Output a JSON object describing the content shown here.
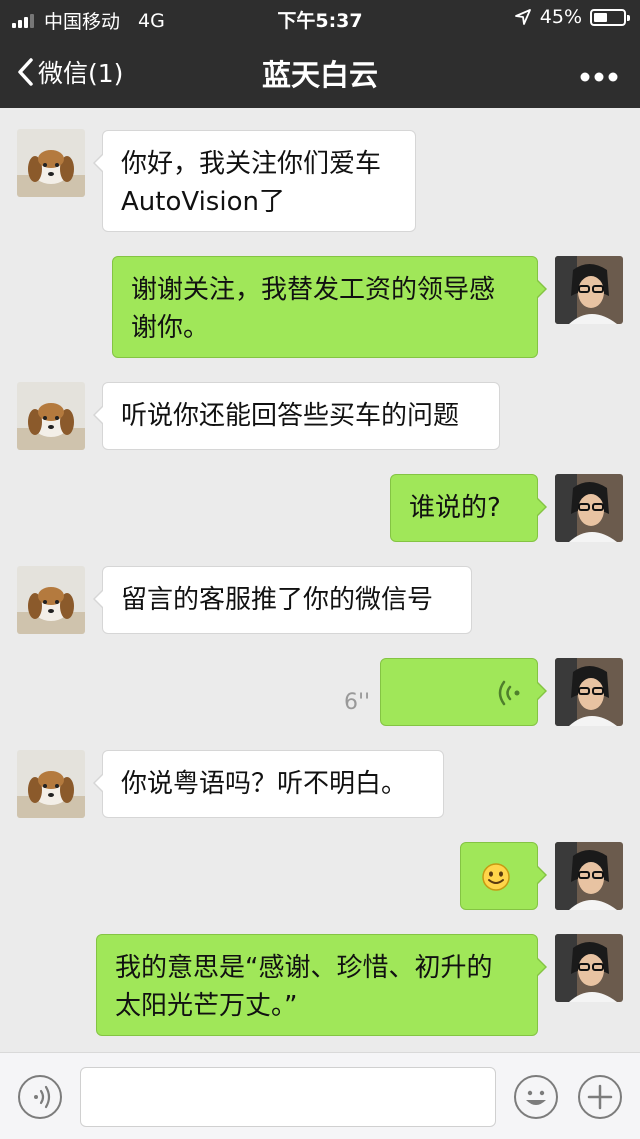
{
  "status_bar": {
    "carrier": "中国移动",
    "network": "4G",
    "time": "下午5:37",
    "battery": "45%",
    "battery_level": 0.45
  },
  "nav": {
    "back_label": "微信(1)",
    "title": "蓝天白云",
    "more_icon": "more-icon"
  },
  "messages": [
    {
      "side": "left",
      "text_lines": [
        "你好，我关注你们爱车",
        "AutoVision了"
      ],
      "avatar": "beagle-avatar"
    },
    {
      "side": "right",
      "text_lines": [
        "谢谢关注，我替发工资的领导感",
        "谢你。"
      ],
      "avatar": "user-avatar"
    },
    {
      "side": "left",
      "text_lines": [
        "听说你还能回答些买车的问题"
      ],
      "avatar": "beagle-avatar"
    },
    {
      "side": "right",
      "text_lines": [
        "谁说的?"
      ],
      "avatar": "user-avatar"
    },
    {
      "side": "left",
      "text_lines": [
        "留言的客服推了你的微信号"
      ],
      "avatar": "beagle-avatar"
    },
    {
      "side": "right",
      "type": "voice",
      "duration": "6''",
      "avatar": "user-avatar"
    },
    {
      "side": "left",
      "text_lines": [
        "你说粤语吗？听不明白。"
      ],
      "avatar": "beagle-avatar"
    },
    {
      "side": "right",
      "type": "emoji",
      "emoji": "smile-emoji",
      "avatar": "user-avatar"
    },
    {
      "side": "right",
      "text_lines": [
        "我的意思是“感谢、珍惜、初升的",
        "太阳光芒万丈。”"
      ],
      "avatar": "user-avatar"
    }
  ],
  "input_bar": {
    "voice_icon": "voice-toggle-icon",
    "input_value": "",
    "emoji_icon": "emoji-icon",
    "plus_icon": "plus-icon"
  }
}
